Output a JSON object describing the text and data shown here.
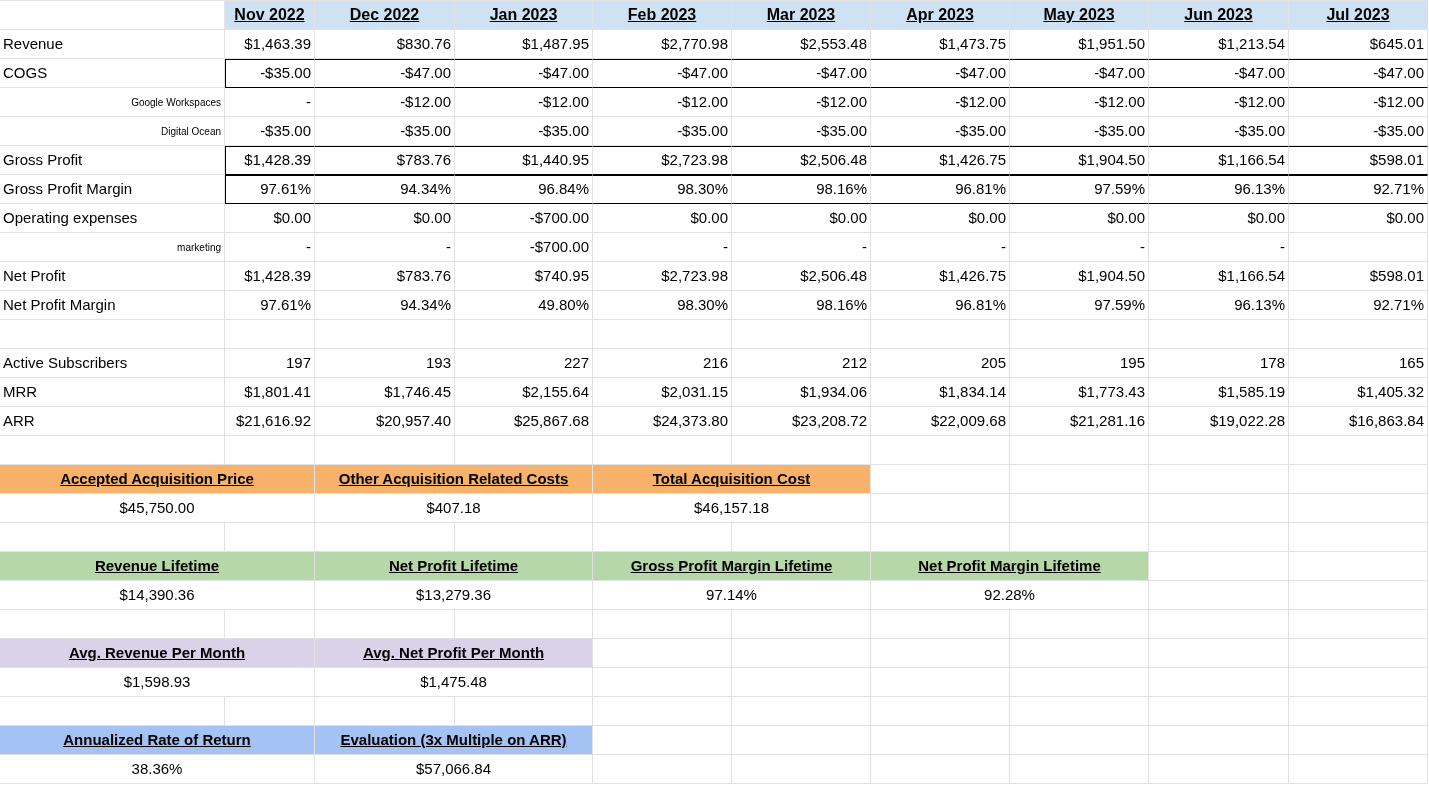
{
  "table": {
    "columns": [
      "Nov 2022",
      "Dec 2022",
      "Jan 2023",
      "Feb 2023",
      "Mar 2023",
      "Apr 2023",
      "May 2023",
      "Jun 2023",
      "Jul 2023"
    ],
    "sections": [
      {
        "rows": [
          {
            "label": "Revenue",
            "kind": "main",
            "values": [
              "$1,463.39",
              "$830.76",
              "$1,487.95",
              "$2,770.98",
              "$2,553.48",
              "$1,473.75",
              "$1,951.50",
              "$1,213.54",
              "$645.01"
            ]
          },
          {
            "label": "COGS",
            "kind": "boxed",
            "values": [
              "-$35.00",
              "-$47.00",
              "-$47.00",
              "-$47.00",
              "-$47.00",
              "-$47.00",
              "-$47.00",
              "-$47.00",
              "-$47.00"
            ]
          },
          {
            "label": "Google Workspaces",
            "kind": "sub",
            "values": [
              "-",
              "-$12.00",
              "-$12.00",
              "-$12.00",
              "-$12.00",
              "-$12.00",
              "-$12.00",
              "-$12.00",
              "-$12.00"
            ]
          },
          {
            "label": "Digital Ocean",
            "kind": "sub",
            "values": [
              "-$35.00",
              "-$35.00",
              "-$35.00",
              "-$35.00",
              "-$35.00",
              "-$35.00",
              "-$35.00",
              "-$35.00",
              "-$35.00"
            ]
          },
          {
            "label": "Gross Profit",
            "kind": "boxed",
            "values": [
              "$1,428.39",
              "$783.76",
              "$1,440.95",
              "$2,723.98",
              "$2,506.48",
              "$1,426.75",
              "$1,904.50",
              "$1,166.54",
              "$598.01"
            ]
          },
          {
            "label": "Gross Profit Margin",
            "kind": "boxed",
            "values": [
              "97.61%",
              "94.34%",
              "96.84%",
              "98.30%",
              "98.16%",
              "96.81%",
              "97.59%",
              "96.13%",
              "92.71%"
            ]
          },
          {
            "label": "Operating expenses",
            "kind": "main",
            "values": [
              "$0.00",
              "$0.00",
              "-$700.00",
              "$0.00",
              "$0.00",
              "$0.00",
              "$0.00",
              "$0.00",
              "$0.00"
            ]
          },
          {
            "label": "marketing",
            "kind": "sub",
            "values": [
              "-",
              "-",
              "-$700.00",
              "-",
              "-",
              "-",
              "-",
              "-"
            ]
          },
          {
            "label": "Net Profit",
            "kind": "main",
            "values": [
              "$1,428.39",
              "$783.76",
              "$740.95",
              "$2,723.98",
              "$2,506.48",
              "$1,426.75",
              "$1,904.50",
              "$1,166.54",
              "$598.01"
            ]
          },
          {
            "label": "Net Profit Margin",
            "kind": "main",
            "values": [
              "97.61%",
              "94.34%",
              "49.80%",
              "98.30%",
              "98.16%",
              "96.81%",
              "97.59%",
              "96.13%",
              "92.71%"
            ]
          }
        ]
      },
      {
        "rows": [
          {
            "label": "Active Subscribers",
            "kind": "main",
            "values": [
              "197",
              "193",
              "227",
              "216",
              "212",
              "205",
              "195",
              "178",
              "165"
            ]
          },
          {
            "label": "MRR",
            "kind": "main",
            "values": [
              "$1,801.41",
              "$1,746.45",
              "$2,155.64",
              "$2,031.15",
              "$1,934.06",
              "$1,834.14",
              "$1,773.43",
              "$1,585.19",
              "$1,405.32"
            ]
          },
          {
            "label": "ARR",
            "kind": "main",
            "values": [
              "$21,616.92",
              "$20,957.40",
              "$25,867.68",
              "$24,373.80",
              "$23,208.72",
              "$22,009.68",
              "$21,281.16",
              "$19,022.28",
              "$16,863.84"
            ]
          }
        ]
      }
    ]
  },
  "summary_blocks": [
    {
      "color": "#f6b26b",
      "items": [
        {
          "label": "Accepted Acquisition Price",
          "value": "$45,750.00"
        },
        {
          "label": "Other Acquisition Related Costs",
          "value": "$407.18"
        },
        {
          "label": "Total Acquisition Cost",
          "value": "$46,157.18"
        }
      ]
    },
    {
      "color": "#b6d7a8",
      "items": [
        {
          "label": "Revenue Lifetime",
          "value": "$14,390.36"
        },
        {
          "label": "Net Profit Lifetime",
          "value": "$13,279.36"
        },
        {
          "label": "Gross Profit Margin Lifetime",
          "value": "97.14%"
        },
        {
          "label": "Net Profit Margin Lifetime",
          "value": "92.28%"
        }
      ]
    },
    {
      "color": "#d9d2e9",
      "items": [
        {
          "label": "Avg. Revenue Per Month",
          "value": "$1,598.93"
        },
        {
          "label": "Avg. Net Profit Per Month",
          "value": "$1,475.48"
        }
      ]
    },
    {
      "color": "#a4c2f4",
      "items": [
        {
          "label": "Annualized Rate of Return",
          "value": "38.36%"
        },
        {
          "label": "Evaluation (3x Multiple on ARR)",
          "value": "$57,066.84"
        }
      ]
    }
  ]
}
